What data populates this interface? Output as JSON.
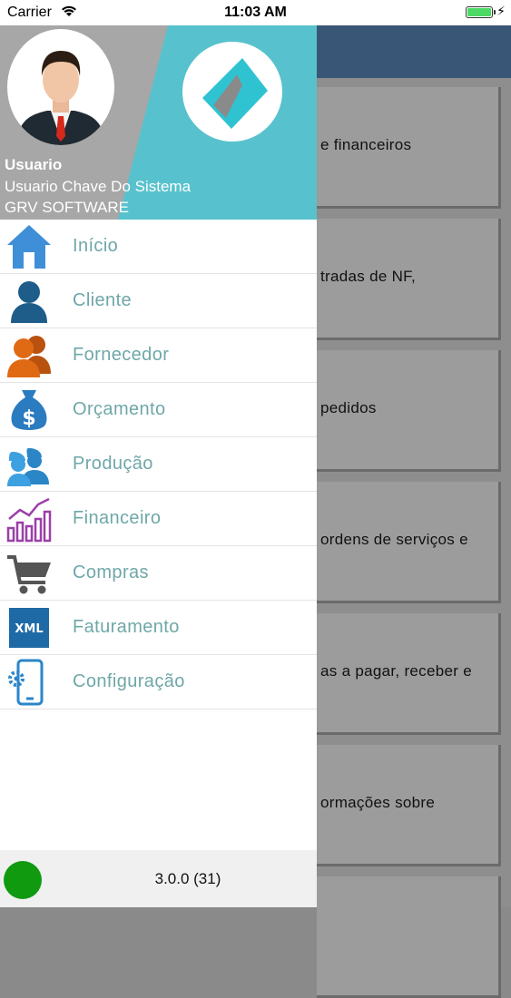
{
  "status_bar": {
    "carrier": "Carrier",
    "time": "11:03 AM"
  },
  "drawer": {
    "user": {
      "name": "Usuario",
      "role": "Usuario Chave Do Sistema",
      "company": "GRV SOFTWARE"
    },
    "menu": [
      {
        "label": "Início",
        "icon": "home-icon"
      },
      {
        "label": "Cliente",
        "icon": "person-icon"
      },
      {
        "label": "Fornecedor",
        "icon": "people-icon"
      },
      {
        "label": "Orçamento",
        "icon": "money-bag-icon"
      },
      {
        "label": "Produção",
        "icon": "workers-icon"
      },
      {
        "label": "Financeiro",
        "icon": "chart-icon"
      },
      {
        "label": "Compras",
        "icon": "cart-icon"
      },
      {
        "label": "Faturamento",
        "icon": "xml-icon"
      },
      {
        "label": "Configuração",
        "icon": "mobile-settings-icon"
      }
    ],
    "xml_icon_text": "XML",
    "version": "3.0.0 (31)"
  },
  "background": {
    "cards": [
      "e financeiros",
      "tradas de NF,",
      "pedidos",
      "ordens de serviços e",
      "as a pagar, receber e",
      "ormações sobre"
    ]
  },
  "colors": {
    "header_teal": "#57c2cd",
    "menu_text": "#6fa7a8",
    "nav_blue": "#3a5676",
    "status_green": "#109a10"
  }
}
